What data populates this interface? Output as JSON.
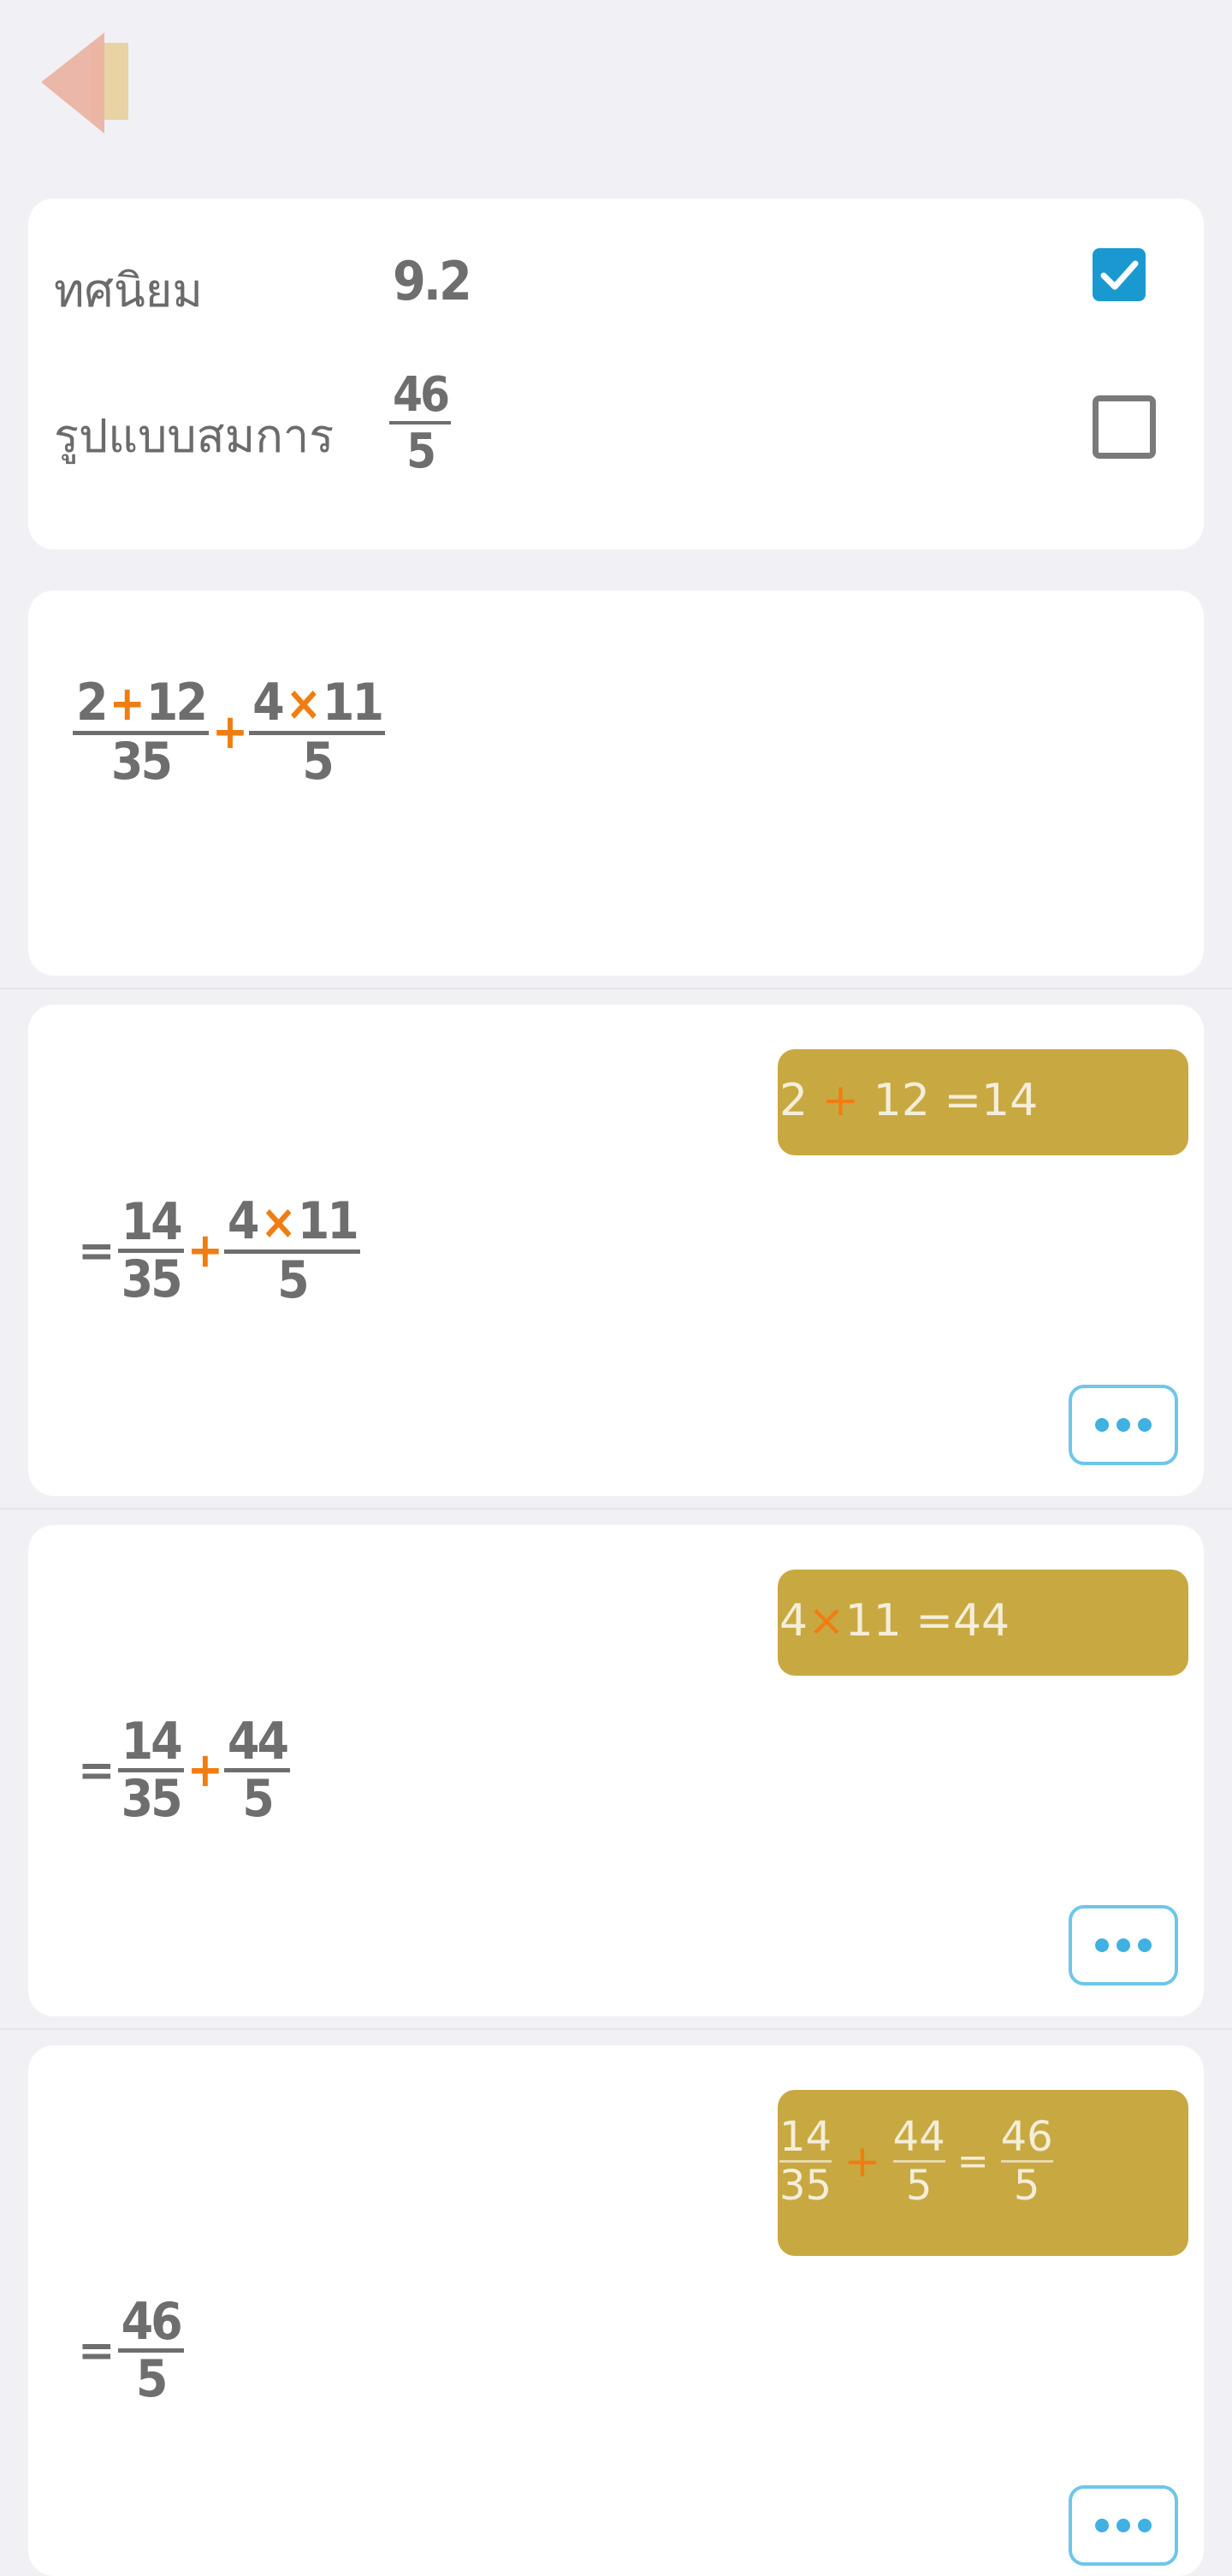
{
  "settings": {
    "decimal_label": "ทศนิยม",
    "decimal_value": "9.2",
    "decimal_checked": true,
    "fraction_label": "รูปแบบสมการ",
    "fraction_num": "46",
    "fraction_den": "5",
    "fraction_checked": false
  },
  "problem": {
    "f1_top_a": "2",
    "f1_op": "+",
    "f1_top_b": "12",
    "f1_den": "35",
    "plus": "+",
    "f2_top_a": "4",
    "f2_op": "×",
    "f2_top_b": "11",
    "f2_den": "5"
  },
  "steps": [
    {
      "hint": {
        "a": "2",
        "op": "+",
        "b": "12",
        "eq": "=",
        "r": "14"
      },
      "eq": "=",
      "f1_top": "14",
      "f1_den": "35",
      "plus": "+",
      "f2_top_a": "4",
      "f2_op": "×",
      "f2_top_b": "11",
      "f2_den": "5"
    },
    {
      "hint": {
        "a": "4",
        "op": "×",
        "b": "11",
        "eq": "=",
        "r": "44"
      },
      "eq": "=",
      "f1_top": "14",
      "f1_den": "35",
      "plus": "+",
      "f2_top": "44",
      "f2_den": "5"
    },
    {
      "hint": {
        "n1": "14",
        "d1": "35",
        "op": "+",
        "n2": "44",
        "d2": "5",
        "eq": "=",
        "n3": "46",
        "d3": "5"
      },
      "eq": "=",
      "f_top": "46",
      "f_den": "5"
    }
  ],
  "colors": {
    "accent_operator": "#f07d12",
    "hint_bg": "#c8a941",
    "checkbox_on": "#1a99d0",
    "more_button": "#3fb1e2"
  },
  "icons": {
    "back": "back-arrow-icon",
    "check": "check-icon",
    "more": "more-dots-icon"
  }
}
